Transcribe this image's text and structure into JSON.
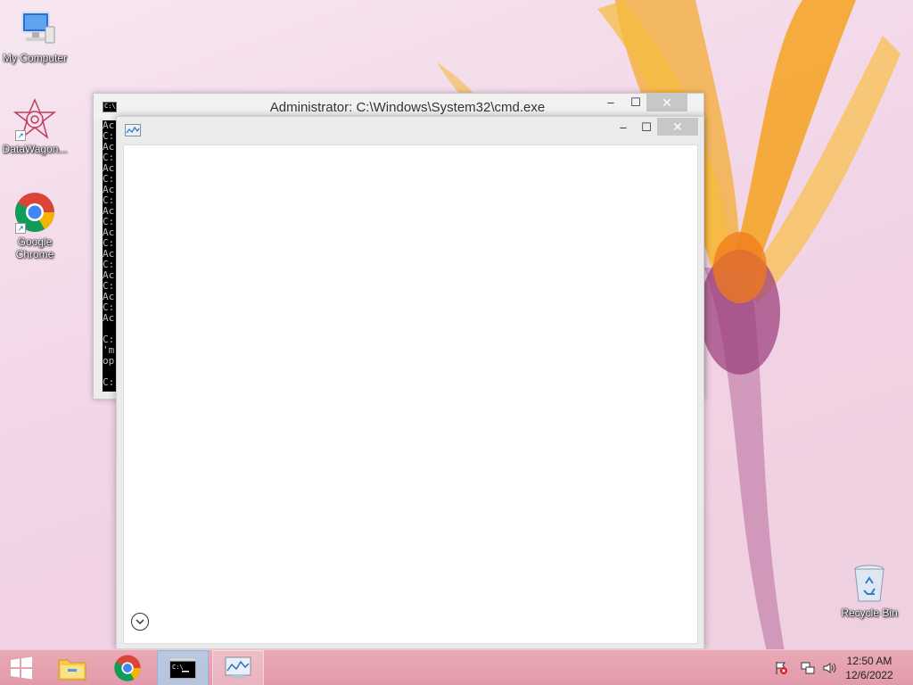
{
  "desktop": {
    "icons": [
      {
        "label": "My Computer"
      },
      {
        "label": "DataWagon..."
      },
      {
        "label": "Google Chrome"
      },
      {
        "label": "Recycle Bin"
      }
    ]
  },
  "cmd_window": {
    "title": "Administrator: C:\\Windows\\System32\\cmd.exe",
    "icon_text": "C:\\",
    "minimize_label": "–",
    "maximize_label": "☐",
    "close_label": "✕",
    "console_lines": [
      "Ac",
      "C:",
      "Ac",
      "C:",
      "Ac",
      "C:",
      "Ac",
      "C:",
      "Ac",
      "C:",
      "Ac",
      "C:",
      "Ac",
      "C:",
      "Ac",
      "C:",
      "Ac",
      "C:",
      "Ac",
      "",
      "C:",
      "'m",
      "op",
      "",
      "C:"
    ]
  },
  "front_window": {
    "minimize_label": "–",
    "maximize_label": "☐",
    "close_label": "✕"
  },
  "taskbar": {
    "start_icon": "windows-logo",
    "clock_time": "12:50 AM",
    "clock_date": "12/6/2022"
  },
  "colors": {
    "taskbar": "#e29aaa",
    "close_button": "#c7c7c7"
  }
}
